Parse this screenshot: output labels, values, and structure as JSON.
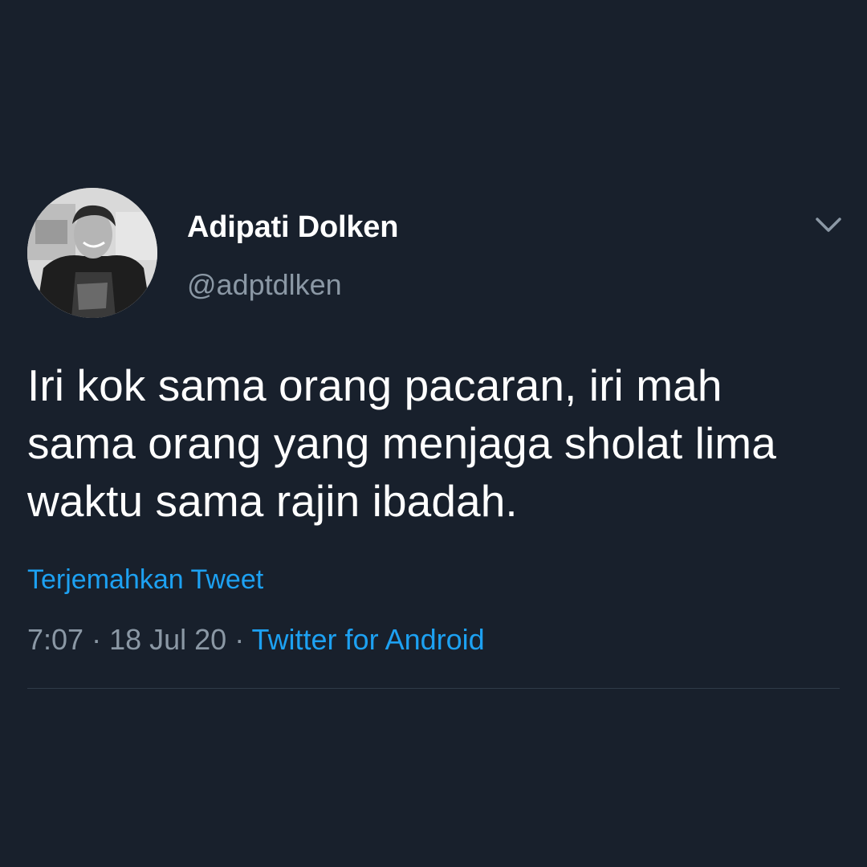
{
  "colors": {
    "background": "#18202c",
    "text_primary": "#ffffff",
    "text_secondary": "#8b98a5",
    "accent": "#1da1f2",
    "divider": "#2f3b48"
  },
  "author": {
    "display_name": "Adipati Dolken",
    "handle": "@adptdlken",
    "avatar_icon": "profile-photo"
  },
  "menu": {
    "icon": "chevron-down-icon"
  },
  "tweet": {
    "text": "Iri kok sama orang pacaran, iri mah\nsama orang yang menjaga sholat lima\nwaktu sama rajin ibadah.",
    "translate_label": "Terjemahkan Tweet",
    "time": "7:07",
    "separator": " · ",
    "date": "18 Jul 20",
    "source": "Twitter for Android"
  }
}
